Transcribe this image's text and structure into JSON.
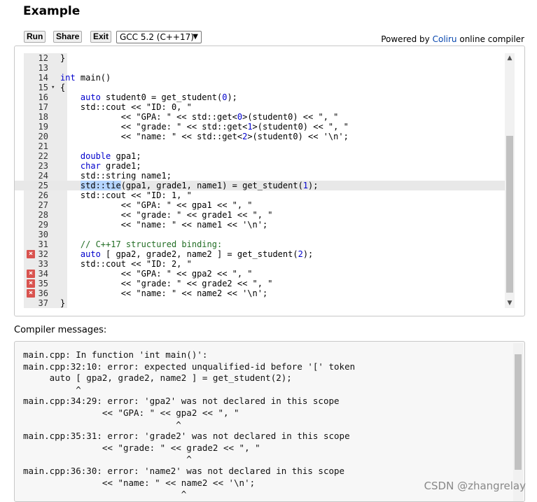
{
  "page": {
    "title": "Example"
  },
  "toolbar": {
    "run_label": "Run",
    "share_label": "Share",
    "exit_label": "Exit",
    "compiler_selected": "GCC 5.2 (C++17)",
    "powered_prefix": "Powered by ",
    "powered_link": "Coliru",
    "powered_suffix": " online compiler"
  },
  "editor": {
    "active_line": "25",
    "error_lines": [
      "32",
      "34",
      "35",
      "36"
    ],
    "lines": [
      {
        "n": "12",
        "text": "}"
      },
      {
        "n": "13",
        "text": ""
      },
      {
        "n": "14",
        "text": "int main()"
      },
      {
        "n": "15",
        "text": "{"
      },
      {
        "n": "16",
        "text": "    auto student0 = get_student(0);"
      },
      {
        "n": "17",
        "text": "    std::cout << \"ID: 0, \""
      },
      {
        "n": "18",
        "text": "            << \"GPA: \" << std::get<0>(student0) << \", \""
      },
      {
        "n": "19",
        "text": "            << \"grade: \" << std::get<1>(student0) << \", \""
      },
      {
        "n": "20",
        "text": "            << \"name: \" << std::get<2>(student0) << '\\n';"
      },
      {
        "n": "21",
        "text": ""
      },
      {
        "n": "22",
        "text": "    double gpa1;"
      },
      {
        "n": "23",
        "text": "    char grade1;"
      },
      {
        "n": "24",
        "text": "    std::string name1;"
      },
      {
        "n": "25",
        "text": "    std::tie(gpa1, grade1, name1) = get_student(1);"
      },
      {
        "n": "26",
        "text": "    std::cout << \"ID: 1, \""
      },
      {
        "n": "27",
        "text": "            << \"GPA: \" << gpa1 << \", \""
      },
      {
        "n": "28",
        "text": "            << \"grade: \" << grade1 << \", \""
      },
      {
        "n": "29",
        "text": "            << \"name: \" << name1 << '\\n';"
      },
      {
        "n": "30",
        "text": ""
      },
      {
        "n": "31",
        "text": "    // C++17 structured binding:"
      },
      {
        "n": "32",
        "text": "    auto [ gpa2, grade2, name2 ] = get_student(2);"
      },
      {
        "n": "33",
        "text": "    std::cout << \"ID: 2, \""
      },
      {
        "n": "34",
        "text": "            << \"GPA: \" << gpa2 << \", \""
      },
      {
        "n": "35",
        "text": "            << \"grade: \" << grade2 << \", \""
      },
      {
        "n": "36",
        "text": "            << \"name: \" << name2 << '\\n';"
      },
      {
        "n": "37",
        "text": "}"
      }
    ]
  },
  "messages": {
    "label": "Compiler messages:",
    "text": "main.cpp: In function 'int main()':\nmain.cpp:32:10: error: expected unqualified-id before '[' token\n     auto [ gpa2, grade2, name2 ] = get_student(2);\n          ^\nmain.cpp:34:29: error: 'gpa2' was not declared in this scope\n               << \"GPA: \" << gpa2 << \", \"\n                             ^\nmain.cpp:35:31: error: 'grade2' was not declared in this scope\n               << \"grade: \" << grade2 << \", \"\n                               ^\nmain.cpp:36:30: error: 'name2' was not declared in this scope\n               << \"name: \" << name2 << '\\n';\n                              ^"
  },
  "watermark": "CSDN @zhangrelay",
  "icons": {
    "error": "error-x-icon",
    "fold": "fold-arrow-icon",
    "dropdown": "chevron-down-icon"
  }
}
